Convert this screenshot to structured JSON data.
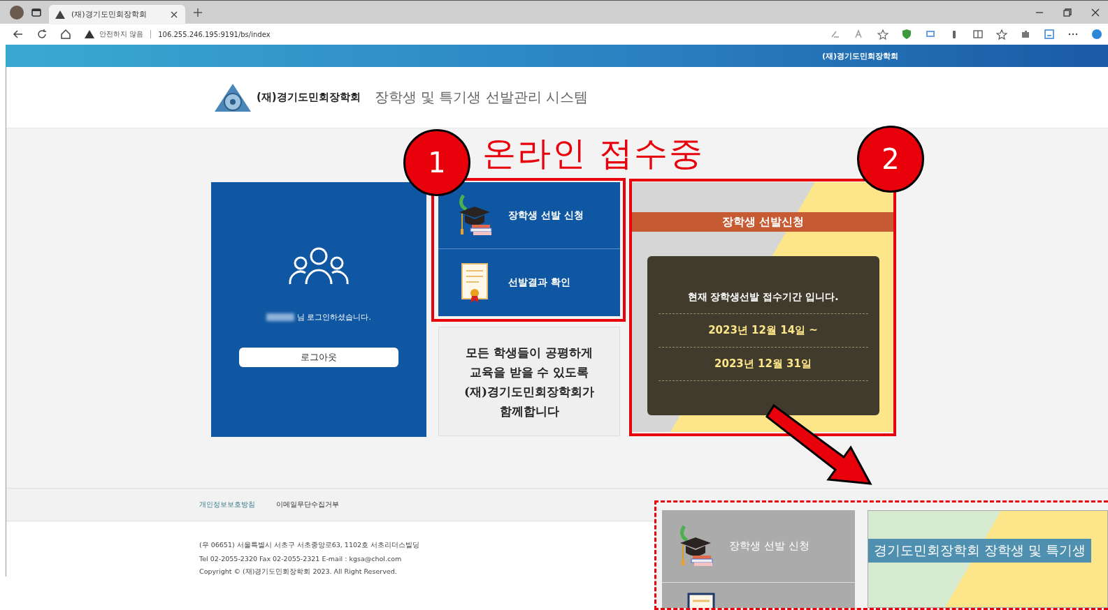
{
  "browser": {
    "tab_title": "(재)경기도민회장학회",
    "address_warning": "안전하지 않음",
    "url": "106.255.246.195:9191/bs/index"
  },
  "site_header": {
    "org_name": "(재)경기도민회장학회"
  },
  "logo": {
    "org_name": "(재)경기도민회장학회",
    "system_title": "장학생 및 특기생 선발관리 시스템"
  },
  "login_card": {
    "user_message": "님 로그인하셨습니다.",
    "logout_button": "로그아웃"
  },
  "menu": {
    "items": [
      {
        "kind": "cap",
        "label": "장학생 선발 신청"
      },
      {
        "kind": "certificate",
        "label": "선발결과 확인"
      }
    ]
  },
  "slogan": {
    "lines": [
      "모든 학생들이 공평하게",
      "교육을 받을 수 있도록",
      "(재)경기도민회장학회가",
      "함께합니다"
    ]
  },
  "notice_card": {
    "banner": "장학생 선발신청",
    "message": "현재 장학생선발 접수기간 입니다.",
    "dates": [
      "2023년 12월 14일 ~",
      "2023년 12월 31일"
    ]
  },
  "footer": {
    "links": [
      "개인정보보호방침",
      "이메일무단수집거부"
    ],
    "info_lines": [
      "(우 06651) 서울특별시 서초구 서초중앙로63, 1102호 서초리더스빌딩",
      "Tel 02-2055-2320 Fax 02-2055-2321 E-mail : kgsa@chol.com",
      "Copyright © (재)경기도민회장학회 2023. All Right Reserved."
    ]
  },
  "annotations": {
    "label": "온라인 접수중",
    "callouts": [
      "1",
      "2"
    ]
  },
  "inset": {
    "menu_items": [
      {
        "kind": "cap",
        "label": "장학생 선발 신청"
      }
    ],
    "banner": "경기도민회장학회 장학생 및 특기생"
  }
}
